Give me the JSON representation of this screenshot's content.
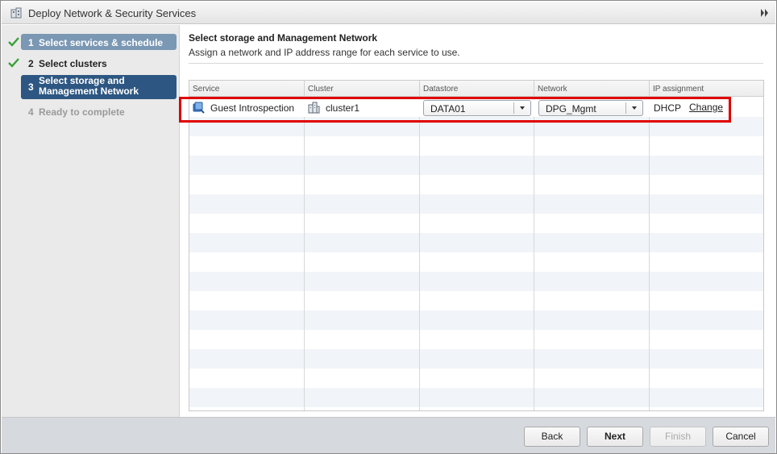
{
  "window": {
    "title": "Deploy Network & Security Services"
  },
  "steps": [
    {
      "num": "1",
      "label": "Select services & schedule",
      "state": "completed"
    },
    {
      "num": "2",
      "label": "Select clusters",
      "state": "completed"
    },
    {
      "num": "3",
      "label": "Select storage and Management Network",
      "state": "current"
    },
    {
      "num": "4",
      "label": "Ready to complete",
      "state": "pending"
    }
  ],
  "main": {
    "heading": "Select storage and Management Network",
    "subheading": "Assign a network and IP address range for each service to use."
  },
  "table": {
    "columns": [
      "Service",
      "Cluster",
      "Datastore",
      "Network",
      "IP assignment"
    ],
    "rows": [
      {
        "service": "Guest Introspection",
        "cluster": "cluster1",
        "datastore": "DATA01",
        "network": "DPG_Mgmt",
        "ip_assignment": "DHCP",
        "action": "Change"
      }
    ]
  },
  "footer": {
    "back": "Back",
    "next": "Next",
    "finish": "Finish",
    "cancel": "Cancel"
  },
  "colors": {
    "completed_step": "#7a97b3",
    "current_step": "#2d5782",
    "check": "#3aa03a",
    "highlight": "#e00000"
  },
  "icons": {
    "title": "building-icon",
    "expand": "double-chevron-right-icon",
    "service": "service-icon",
    "cluster": "cluster-icon",
    "check": "check-icon"
  }
}
